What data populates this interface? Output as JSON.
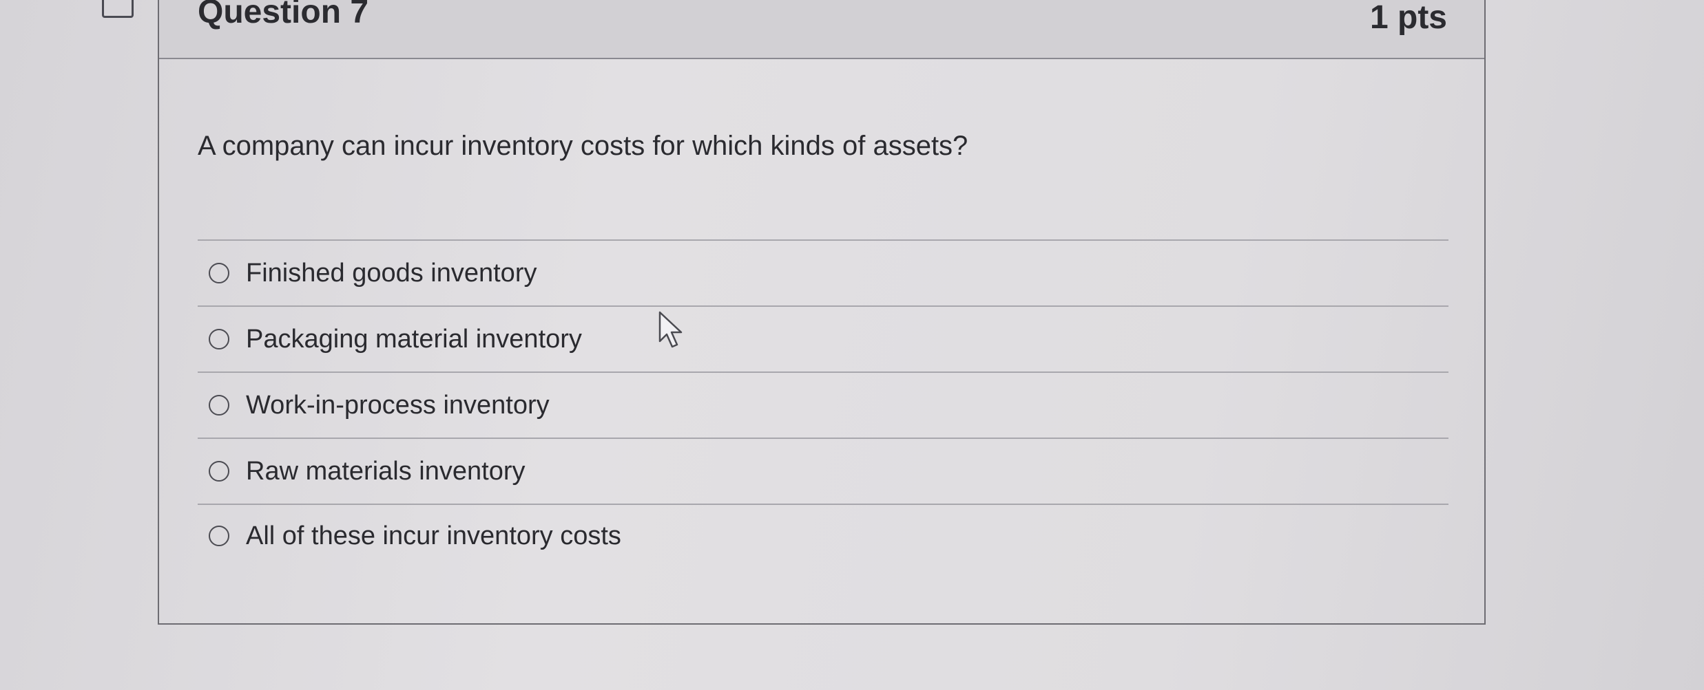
{
  "question": {
    "title": "Question 7",
    "points": "1 pts",
    "prompt": "A company can incur inventory costs for which kinds of assets?",
    "answers": [
      {
        "label": "Finished goods inventory",
        "selected": false
      },
      {
        "label": "Packaging material inventory",
        "selected": false
      },
      {
        "label": "Work-in-process inventory",
        "selected": false
      },
      {
        "label": "Raw materials inventory",
        "selected": false
      },
      {
        "label": "All of these incur inventory costs",
        "selected": false
      }
    ]
  },
  "icons": {
    "flag": "flag-question-icon",
    "radio": "radio-button-icon",
    "cursor": "mouse-pointer-icon"
  },
  "colors": {
    "background": "#dcdadd",
    "header_background": "#d2d0d4",
    "text": "#2a2a2f",
    "border": "#6d6c72"
  }
}
